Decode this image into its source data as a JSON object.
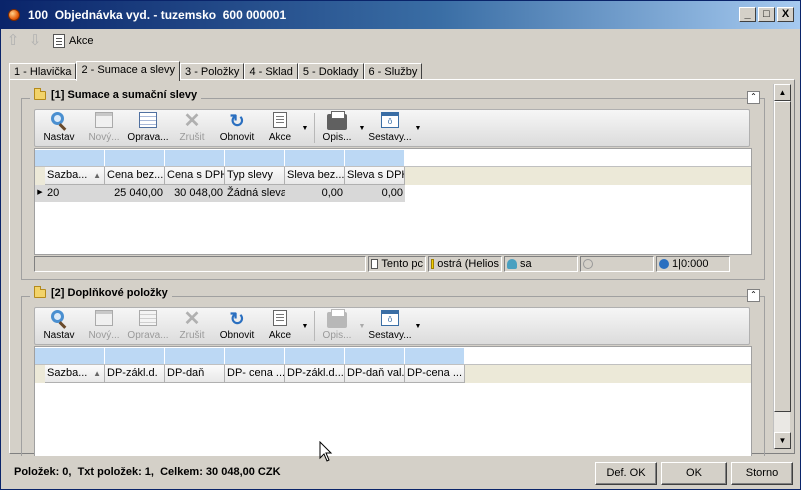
{
  "window": {
    "title": "100  Objednávka vyd. - tuzemsko  600 000001",
    "min": "_",
    "max": "□",
    "close": "X"
  },
  "topbar": {
    "akce": "Akce"
  },
  "tabs": [
    "1 - Hlavička",
    "2 - Sumace a slevy",
    "3 - Položky",
    "4 - Sklad",
    "5 - Doklady",
    "6 - Služby"
  ],
  "group1": {
    "title": "[1] Sumace a sumační slevy",
    "toolbar": {
      "nastav": "Nastav",
      "novy": "Nový...",
      "oprava": "Oprava...",
      "zrusit": "Zrušit",
      "obnovit": "Obnovit",
      "akce": "Akce",
      "opis": "Opis...",
      "sestavy": "Sestavy..."
    },
    "columns": [
      "Sazba...",
      "Cena bez...",
      "Cena s DPH",
      "Typ slevy",
      "Sleva bez...",
      "Sleva s DPH"
    ],
    "rows": [
      [
        "20",
        "25 040,00",
        "30 048,00",
        "Žádná sleva",
        "0,00",
        "0,00"
      ]
    ],
    "status": {
      "doc": "Tento pc",
      "db": "ostrá (Helios",
      "user": "sa",
      "search": "",
      "info": "1|0:000"
    }
  },
  "group2": {
    "title": "[2] Doplňkové položky",
    "toolbar": {
      "nastav": "Nastav",
      "novy": "Nový...",
      "oprava": "Oprava...",
      "zrusit": "Zrušit",
      "obnovit": "Obnovit",
      "akce": "Akce",
      "opis": "Opis...",
      "sestavy": "Sestavy..."
    },
    "columns": [
      "Sazba...",
      "DP-zákl.d.",
      "DP-daň",
      "DP- cena ...",
      "DP-zákl.d....",
      "DP-daň val.",
      "DP-cena ..."
    ]
  },
  "footer": {
    "summary": "Položek: 0,  Txt položek: 1,  Celkem: 30 048,00 CZK",
    "def_ok": "Def. OK",
    "ok": "OK",
    "storno": "Storno"
  }
}
